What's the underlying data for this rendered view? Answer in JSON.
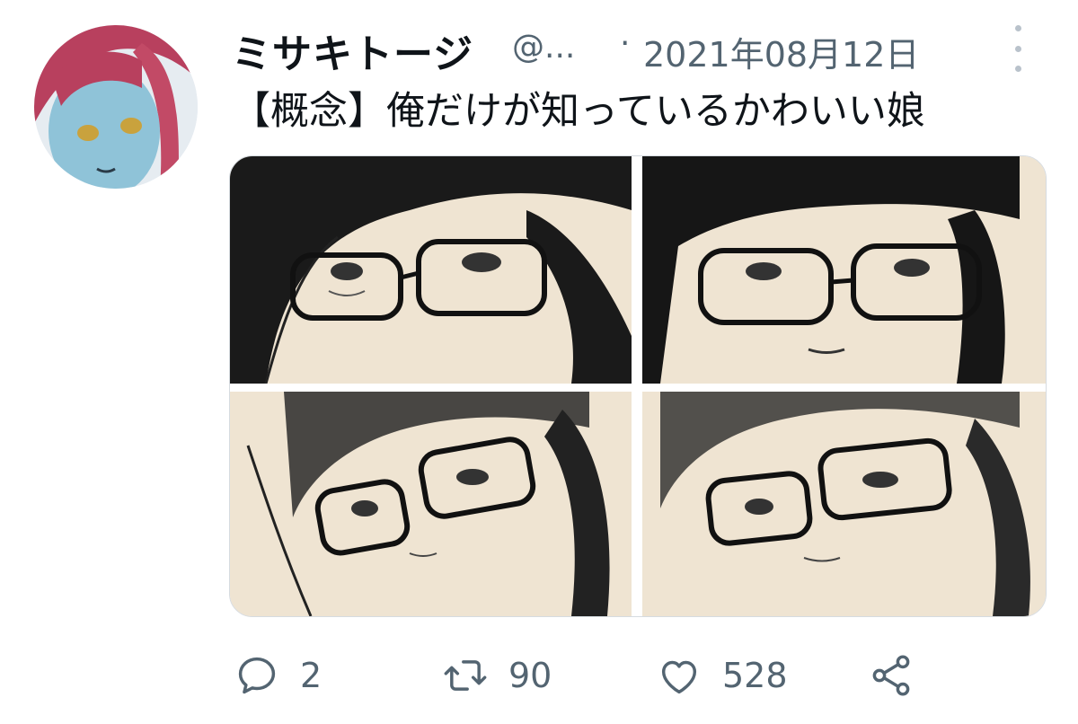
{
  "author": {
    "display_name": "ミサキトージ",
    "handle": "@...",
    "separator": "·",
    "date": "2021年08月12日"
  },
  "tweet": {
    "text": "【概念】俺だけが知っているかわいい娘",
    "media_count": 4
  },
  "actions": {
    "reply_count": "2",
    "retweet_count": "90",
    "like_count": "528"
  },
  "icons": {
    "more": "more-vertical-icon",
    "reply": "reply-icon",
    "retweet": "retweet-icon",
    "like": "heart-icon",
    "share": "share-icon"
  },
  "colors": {
    "text_primary": "#0f1419",
    "text_secondary": "#536471",
    "media_paper": "#efe4d2"
  }
}
